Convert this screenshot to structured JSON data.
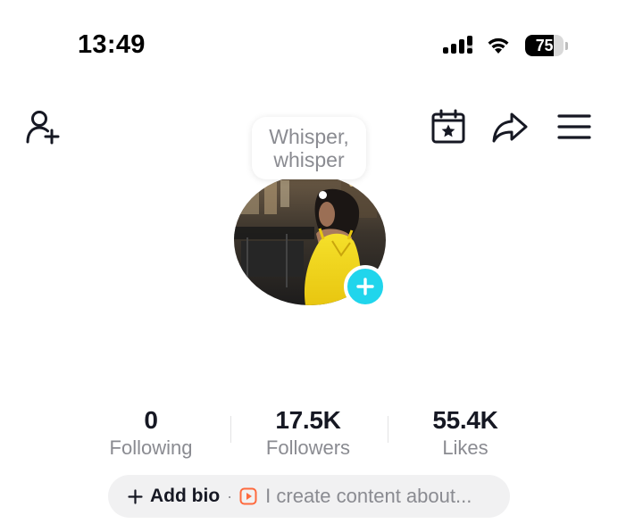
{
  "status_bar": {
    "time": "13:49",
    "battery_level": "75",
    "battery_fraction": 0.75,
    "signal_icon": "signal-icon",
    "wifi_icon": "wifi-icon"
  },
  "nav": {
    "left_icon": "add-friend-icon",
    "right_icons": [
      "calendar-star-icon",
      "share-icon",
      "menu-icon"
    ]
  },
  "profile": {
    "bubble_line1": "Whisper,",
    "bubble_line2": "whisper",
    "avatar_add_icon": "plus-icon"
  },
  "stats": {
    "following": {
      "value": "0",
      "label": "Following"
    },
    "followers": {
      "value": "17.5K",
      "label": "Followers"
    },
    "likes": {
      "value": "55.4K",
      "label": "Likes"
    }
  },
  "bio": {
    "add_label": "Add bio",
    "separator": "·",
    "placeholder": "I create content about..."
  },
  "colors": {
    "accent_cyan": "#20d5ec",
    "accent_orange": "#fe6a3e",
    "text_primary": "#161823",
    "text_secondary": "#8a8b91",
    "pill_bg": "#f1f1f2"
  }
}
